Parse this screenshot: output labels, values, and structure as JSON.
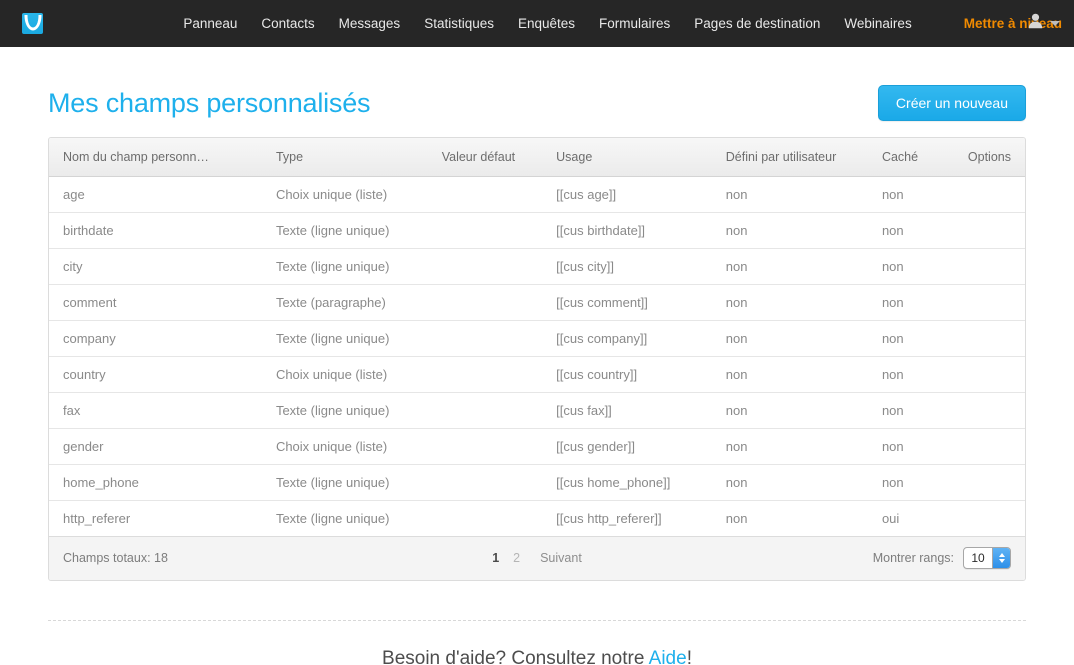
{
  "nav": {
    "logo_icon": "envelope-logo-icon",
    "links": [
      {
        "label": "Panneau"
      },
      {
        "label": "Contacts"
      },
      {
        "label": "Messages"
      },
      {
        "label": "Statistiques"
      },
      {
        "label": "Enquêtes"
      },
      {
        "label": "Formulaires"
      },
      {
        "label": "Pages de destination"
      },
      {
        "label": "Webinaires"
      }
    ],
    "upgrade_label": "Mettre à niveau",
    "user_icon": "user-avatar-icon",
    "caret_icon": "chevron-down-icon",
    "accent_orange": "#f08a00",
    "background": "#262626"
  },
  "header": {
    "title": "Mes champs personnalisés",
    "create_button": "Créer un nouveau",
    "title_color": "#1eb0ec",
    "button_color": "#1aa9e8"
  },
  "table": {
    "columns": [
      "Nom du champ personn…",
      "Type",
      "Valeur défaut",
      "Usage",
      "Défini par utilisateur",
      "Caché",
      "Options"
    ],
    "rows": [
      {
        "name": "age",
        "type": "Choix unique (liste)",
        "default": "",
        "usage": "[[cus age]]",
        "userdef": "non",
        "hidden": "non",
        "options": ""
      },
      {
        "name": "birthdate",
        "type": "Texte (ligne unique)",
        "default": "",
        "usage": "[[cus birthdate]]",
        "userdef": "non",
        "hidden": "non",
        "options": ""
      },
      {
        "name": "city",
        "type": "Texte (ligne unique)",
        "default": "",
        "usage": "[[cus city]]",
        "userdef": "non",
        "hidden": "non",
        "options": ""
      },
      {
        "name": "comment",
        "type": "Texte (paragraphe)",
        "default": "",
        "usage": "[[cus comment]]",
        "userdef": "non",
        "hidden": "non",
        "options": ""
      },
      {
        "name": "company",
        "type": "Texte (ligne unique)",
        "default": "",
        "usage": "[[cus company]]",
        "userdef": "non",
        "hidden": "non",
        "options": ""
      },
      {
        "name": "country",
        "type": "Choix unique (liste)",
        "default": "",
        "usage": "[[cus country]]",
        "userdef": "non",
        "hidden": "non",
        "options": ""
      },
      {
        "name": "fax",
        "type": "Texte (ligne unique)",
        "default": "",
        "usage": "[[cus fax]]",
        "userdef": "non",
        "hidden": "non",
        "options": ""
      },
      {
        "name": "gender",
        "type": "Choix unique (liste)",
        "default": "",
        "usage": "[[cus gender]]",
        "userdef": "non",
        "hidden": "non",
        "options": ""
      },
      {
        "name": "home_phone",
        "type": "Texte (ligne unique)",
        "default": "",
        "usage": "[[cus home_phone]]",
        "userdef": "non",
        "hidden": "non",
        "options": ""
      },
      {
        "name": "http_referer",
        "type": "Texte (ligne unique)",
        "default": "",
        "usage": "[[cus http_referer]]",
        "userdef": "non",
        "hidden": "oui",
        "options": ""
      }
    ]
  },
  "footer": {
    "total_label": "Champs totaux: 18",
    "page_current": "1",
    "page_two": "2",
    "next_label": "Suivant",
    "rows_label": "Montrer rangs:",
    "rows_value": "10"
  },
  "help": {
    "text_before": "Besoin d'aide? Consultez notre ",
    "link": "Aide",
    "text_after": "!"
  }
}
